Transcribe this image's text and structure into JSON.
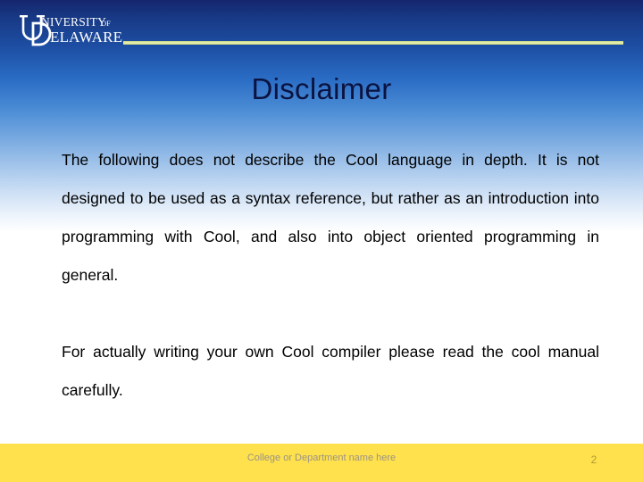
{
  "slide": {
    "title": "Disclaimer",
    "page_number": "2"
  },
  "branding": {
    "logo_name": "university-of-delaware-logo",
    "logo_line1": "UNIVERSITY OF",
    "logo_line2": "DELAWARE",
    "monogram": "UD",
    "rule_color": "#e4eda8"
  },
  "body": {
    "paragraph1": "The following does not describe the Cool language in depth.  It is not designed to be used as a syntax reference, but rather as an introduction into programming with Cool, and also into object oriented programming in general.",
    "paragraph2": "For actually writing your own Cool compiler please read the cool manual carefully."
  },
  "footer": {
    "text": "College or Department name here",
    "bar_color": "#ffe14d"
  },
  "theme": {
    "gradient_top": "#15256e",
    "gradient_mid": "#2a6cc4",
    "gradient_bottom": "#ffffff",
    "title_color": "#0b1340",
    "body_color": "#000000",
    "footer_text_color": "#9b9384",
    "page_number_color": "#b09a32"
  }
}
